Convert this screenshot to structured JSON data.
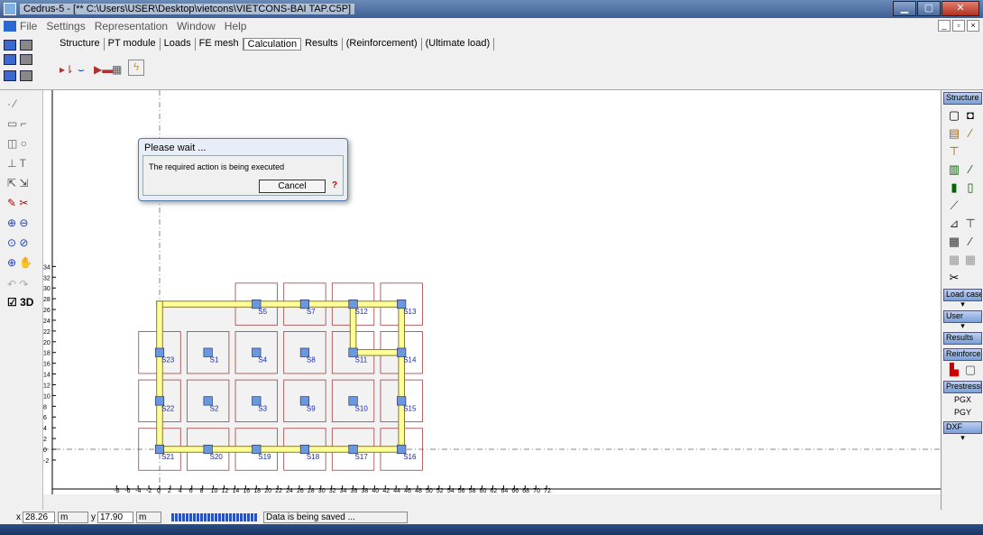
{
  "window": {
    "title": "Cedrus-5 - [** C:\\Users\\USER\\Desktop\\vietcons\\VIETCONS-BAI TAP.C5P]"
  },
  "menu": [
    "File",
    "Settings",
    "Representation",
    "Window",
    "Help"
  ],
  "tabs": [
    "Structure",
    "PT module",
    "Loads",
    "FE mesh",
    "Calculation",
    "Results",
    "(Reinforcement)",
    "(Ultimate load)"
  ],
  "active_tab": "Calculation",
  "left_panel": {
    "label_3d": "3D"
  },
  "right_panel": {
    "structure": "Structure",
    "load_cases": "Load cases",
    "user": "User",
    "results": "Results",
    "reinforcement": "Reinforcem",
    "prestressing": "Prestressin",
    "pgx": "PGX",
    "pgy": "PGY",
    "dxf": "DXF"
  },
  "axis": {
    "x_ticks": [
      -8,
      -6,
      -4,
      -2,
      0,
      2,
      4,
      6,
      8,
      10,
      12,
      14,
      16,
      18,
      20,
      22,
      24,
      26,
      28,
      30,
      32,
      34,
      36,
      38,
      40,
      42,
      44,
      46,
      48,
      50,
      52,
      54,
      56,
      58,
      60,
      62,
      64,
      66,
      68,
      70,
      72
    ],
    "y_ticks": [
      34,
      32,
      30,
      28,
      26,
      24,
      22,
      20,
      18,
      16,
      14,
      12,
      10,
      8,
      6,
      4,
      2,
      0,
      -2
    ]
  },
  "supports": [
    {
      "name": "S1",
      "x": 9,
      "y": 18
    },
    {
      "name": "S2",
      "x": 9,
      "y": 9
    },
    {
      "name": "S3",
      "x": 18,
      "y": 9
    },
    {
      "name": "S4",
      "x": 18,
      "y": 18
    },
    {
      "name": "S5",
      "x": 18,
      "y": 27
    },
    {
      "name": "S7",
      "x": 27,
      "y": 27
    },
    {
      "name": "S8",
      "x": 27,
      "y": 18
    },
    {
      "name": "S9",
      "x": 27,
      "y": 9
    },
    {
      "name": "S10",
      "x": 36,
      "y": 9
    },
    {
      "name": "S11",
      "x": 36,
      "y": 18
    },
    {
      "name": "S12",
      "x": 36,
      "y": 27
    },
    {
      "name": "S13",
      "x": 45,
      "y": 27
    },
    {
      "name": "S14",
      "x": 45,
      "y": 18
    },
    {
      "name": "S15",
      "x": 45,
      "y": 9
    },
    {
      "name": "S16",
      "x": 45,
      "y": 0
    },
    {
      "name": "S17",
      "x": 36,
      "y": 0
    },
    {
      "name": "S18",
      "x": 27,
      "y": 0
    },
    {
      "name": "S19",
      "x": 18,
      "y": 0
    },
    {
      "name": "S20",
      "x": 9,
      "y": 0
    },
    {
      "name": "S21",
      "x": 0,
      "y": 0
    },
    {
      "name": "S22",
      "x": 0,
      "y": 9
    },
    {
      "name": "S23",
      "x": 0,
      "y": 18
    }
  ],
  "dialog": {
    "title": "Please wait ...",
    "message": "The required action is being executed",
    "cancel": "Cancel",
    "help": "?"
  },
  "status": {
    "x_label": "x",
    "x_value": "28.26",
    "x_unit": "m",
    "y_label": "y",
    "y_value": "17.90",
    "y_unit": "m",
    "message": "Data is being saved ..."
  },
  "colors": {
    "wall_fill": "#ffff99",
    "wall_stroke": "#8a7a2a",
    "support": "#6a98e0",
    "slab": "#f2f2f2",
    "head": "#a04040",
    "label": "#1a2aa0"
  }
}
